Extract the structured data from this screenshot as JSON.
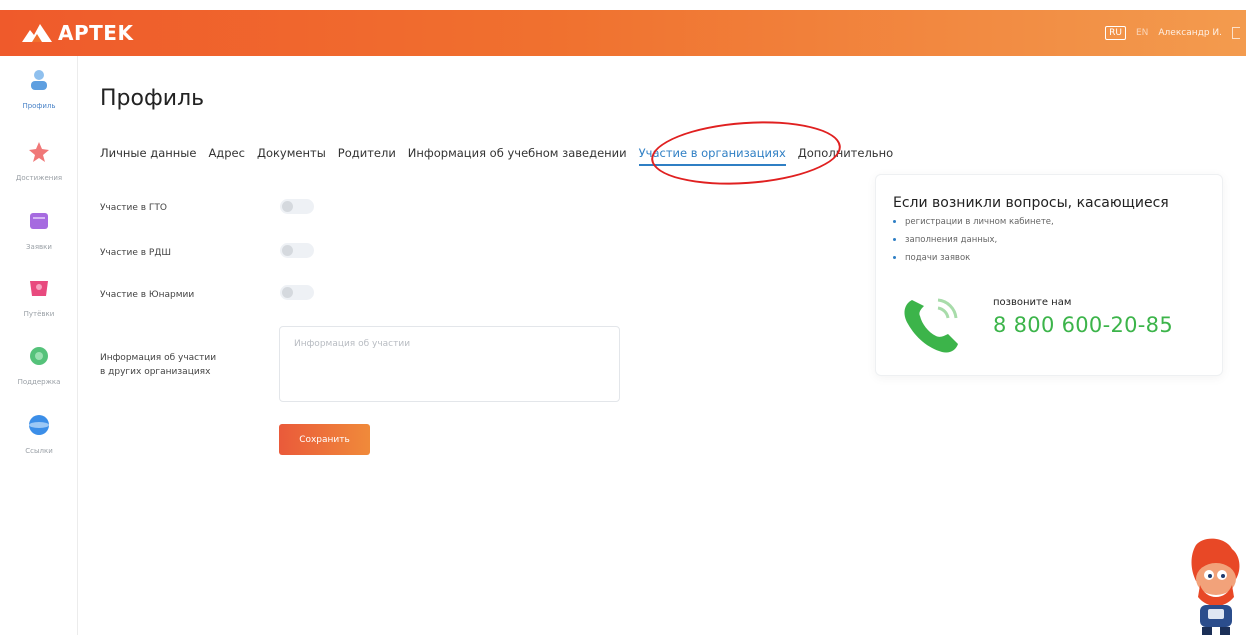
{
  "header": {
    "logo_text": "APTEK",
    "lang_active": "RU",
    "lang_other": "EN",
    "user_name": "Александр И."
  },
  "sidebar": {
    "items": [
      {
        "label": "Профиль",
        "icon": "profile-icon",
        "color": "#7fb2e8",
        "active": true
      },
      {
        "label": "Достижения",
        "icon": "achievements-icon",
        "color": "#f07878",
        "active": false
      },
      {
        "label": "Заявки",
        "icon": "applications-icon",
        "color": "#a66be0",
        "active": false
      },
      {
        "label": "Путёвки",
        "icon": "vouchers-icon",
        "color": "#e84a7e",
        "active": false
      },
      {
        "label": "Поддержка",
        "icon": "support-icon",
        "color": "#55c27a",
        "active": false
      },
      {
        "label": "Ссылки",
        "icon": "links-icon",
        "color": "#3b8ee8",
        "active": false
      }
    ]
  },
  "page": {
    "title": "Профиль",
    "tabs": [
      {
        "label": "Личные данные",
        "active": false
      },
      {
        "label": "Адрес",
        "active": false
      },
      {
        "label": "Документы",
        "active": false
      },
      {
        "label": "Родители",
        "active": false
      },
      {
        "label": "Информация об учебном заведении",
        "active": false
      },
      {
        "label": "Участие в организациях",
        "active": true
      },
      {
        "label": "Дополнительно",
        "active": false
      }
    ]
  },
  "form": {
    "gto_label": "Участие в ГТО",
    "rdsh_label": "Участие в РДШ",
    "yunarmia_label": "Участие в Юнармии",
    "other_orgs_label_line1": "Информация об участии",
    "other_orgs_label_line2": "в других организациях",
    "other_orgs_placeholder": "Информация об участии",
    "other_orgs_value": "",
    "save_label": "Сохранить"
  },
  "help": {
    "title": "Если возникли вопросы, касающиеся",
    "items": [
      "регистрации в личном кабинете,",
      "заполнения данных,",
      "подачи заявок"
    ],
    "call_label": "позвоните нам",
    "phone": "8 800 600-20-85"
  },
  "colors": {
    "accent_orange": "#f0712f",
    "active_tab": "#2f7fc4",
    "phone_green": "#3cb44a",
    "highlight_red": "#e02020"
  }
}
